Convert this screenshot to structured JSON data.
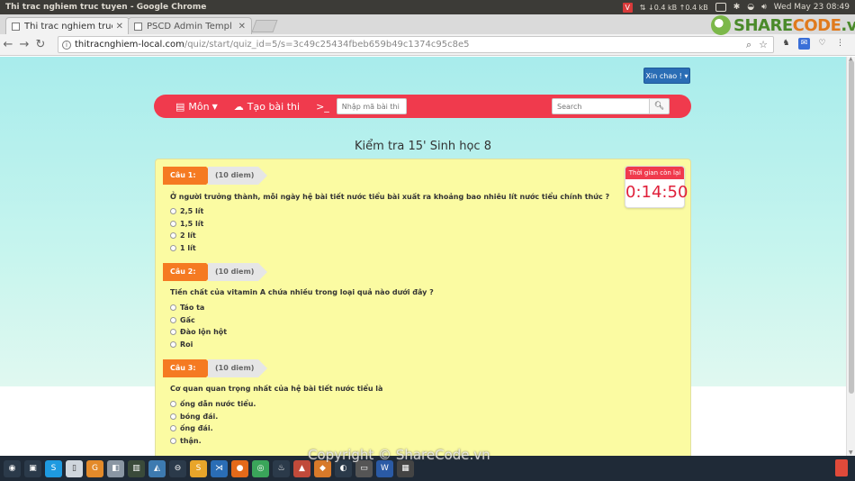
{
  "os_bar": {
    "window_title": "Thi trac nghiem truc tuyen - Google Chrome",
    "net_down": "0.4 kB",
    "net_up": "0.4 kB",
    "clock": "Wed May 23 08:49"
  },
  "browser": {
    "tabs": [
      {
        "label": "Thi trac nghiem truc",
        "active": true
      },
      {
        "label": "PSCD Admin Templ",
        "active": false
      }
    ],
    "url_host": "thitracnghiem-local.com",
    "url_path": "/quiz/start/quiz_id=5/s=3c49c25434fbeb659b49c1374c95c8e5"
  },
  "logo": {
    "brand_a": "SHARE",
    "brand_b": "CODE",
    "suffix": ".vn"
  },
  "page": {
    "greeting": "Xin chao !",
    "nav": {
      "subject_label": "Môn",
      "create_label": "Tạo bài thi",
      "prompt_symbol": ">_",
      "exam_code_placeholder": "Nhập mã bài thi",
      "search_placeholder": "Search"
    },
    "quiz_title": "Kiểm tra 15' Sinh học 8",
    "timer": {
      "label": "Thời gian còn lại",
      "value": "0:14:50"
    },
    "questions": [
      {
        "tag": "Câu 1:",
        "points": "(10 diem)",
        "text": "Ở người trưởng thành, mỗi ngày hệ bài tiết nước tiểu bài xuất ra khoảng bao nhiêu lít nước tiểu chính thức ?",
        "options": [
          "2,5 lít",
          "1,5 lít",
          "2 lít",
          "1 lít"
        ]
      },
      {
        "tag": "Câu 2:",
        "points": "(10 diem)",
        "text": "Tiền chất của vitamin A chứa nhiều trong loại quả nào dưới đây ?",
        "options": [
          "Táo ta",
          "Gấc",
          "Đào lộn hột",
          "Roi"
        ]
      },
      {
        "tag": "Câu 3:",
        "points": "(10 diem)",
        "text": "Cơ quan quan trọng nhất của hệ bài tiết nước tiểu là",
        "options": [
          "ống dẫn nước tiểu.",
          "bóng đái.",
          "ống đái.",
          "thận."
        ]
      }
    ]
  },
  "watermark": "Copyright © ShareCode.vn",
  "colors": {
    "nav_red": "#f03a4d",
    "tag_orange": "#f57a22",
    "panel_yellow": "#fbfba2",
    "greeting_blue": "#2a6db5"
  }
}
